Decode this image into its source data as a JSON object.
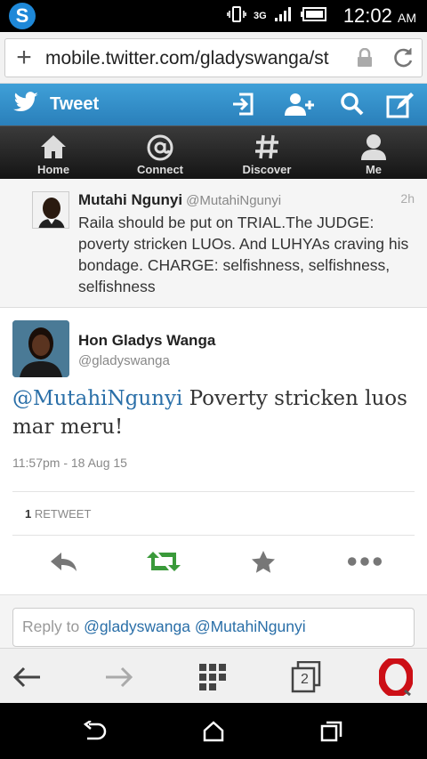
{
  "status_bar": {
    "network": "3G",
    "time": "12:02",
    "ampm": "AM"
  },
  "browser": {
    "url": "mobile.twitter.com/gladyswanga/st"
  },
  "header": {
    "title": "Tweet"
  },
  "nav": {
    "items": [
      {
        "label": "Home"
      },
      {
        "label": "Connect"
      },
      {
        "label": "Discover"
      },
      {
        "label": "Me"
      }
    ]
  },
  "parent_tweet": {
    "name": "Mutahi Ngunyi",
    "handle": "@MutahiNgunyi",
    "age": "2h",
    "text": "Raila should be put on TRIAL.The JUDGE: poverty stricken LUOs. And LUHYAs craving his bondage. CHARGE: selfishness, selfishness, selfishness"
  },
  "tweet": {
    "name": "Hon Gladys Wanga",
    "handle": "@gladyswanga",
    "mention": "@MutahiNgunyi",
    "text": " Poverty stricken luos mar meru!",
    "timestamp": "11:57pm - 18 Aug 15",
    "retweet_count": "1",
    "retweet_label": "RETWEET"
  },
  "reply": {
    "prefix": "Reply to ",
    "mentions": "@gladyswanga @MutahiNgunyi"
  },
  "opera": {
    "tab_count": "2"
  },
  "colors": {
    "twitter_blue": "#3fa0d8",
    "retweet_green": "#3a9a3a",
    "link_blue": "#2a6fa8",
    "opera_red": "#cc0f16"
  }
}
